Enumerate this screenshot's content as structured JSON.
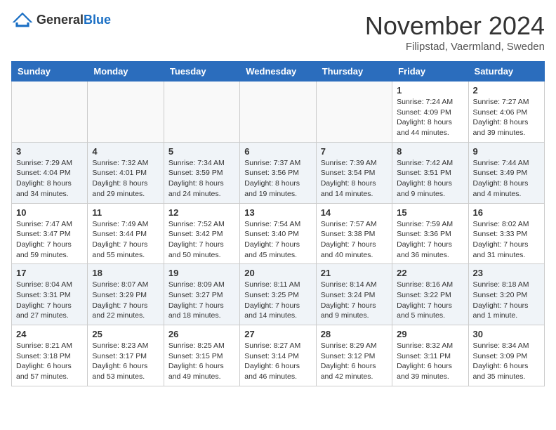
{
  "header": {
    "logo_general": "General",
    "logo_blue": "Blue",
    "month_title": "November 2024",
    "location": "Filipstad, Vaermland, Sweden"
  },
  "weekdays": [
    "Sunday",
    "Monday",
    "Tuesday",
    "Wednesday",
    "Thursday",
    "Friday",
    "Saturday"
  ],
  "weeks": [
    [
      {
        "day": "",
        "info": ""
      },
      {
        "day": "",
        "info": ""
      },
      {
        "day": "",
        "info": ""
      },
      {
        "day": "",
        "info": ""
      },
      {
        "day": "",
        "info": ""
      },
      {
        "day": "1",
        "info": "Sunrise: 7:24 AM\nSunset: 4:09 PM\nDaylight: 8 hours\nand 44 minutes."
      },
      {
        "day": "2",
        "info": "Sunrise: 7:27 AM\nSunset: 4:06 PM\nDaylight: 8 hours\nand 39 minutes."
      }
    ],
    [
      {
        "day": "3",
        "info": "Sunrise: 7:29 AM\nSunset: 4:04 PM\nDaylight: 8 hours\nand 34 minutes."
      },
      {
        "day": "4",
        "info": "Sunrise: 7:32 AM\nSunset: 4:01 PM\nDaylight: 8 hours\nand 29 minutes."
      },
      {
        "day": "5",
        "info": "Sunrise: 7:34 AM\nSunset: 3:59 PM\nDaylight: 8 hours\nand 24 minutes."
      },
      {
        "day": "6",
        "info": "Sunrise: 7:37 AM\nSunset: 3:56 PM\nDaylight: 8 hours\nand 19 minutes."
      },
      {
        "day": "7",
        "info": "Sunrise: 7:39 AM\nSunset: 3:54 PM\nDaylight: 8 hours\nand 14 minutes."
      },
      {
        "day": "8",
        "info": "Sunrise: 7:42 AM\nSunset: 3:51 PM\nDaylight: 8 hours\nand 9 minutes."
      },
      {
        "day": "9",
        "info": "Sunrise: 7:44 AM\nSunset: 3:49 PM\nDaylight: 8 hours\nand 4 minutes."
      }
    ],
    [
      {
        "day": "10",
        "info": "Sunrise: 7:47 AM\nSunset: 3:47 PM\nDaylight: 7 hours\nand 59 minutes."
      },
      {
        "day": "11",
        "info": "Sunrise: 7:49 AM\nSunset: 3:44 PM\nDaylight: 7 hours\nand 55 minutes."
      },
      {
        "day": "12",
        "info": "Sunrise: 7:52 AM\nSunset: 3:42 PM\nDaylight: 7 hours\nand 50 minutes."
      },
      {
        "day": "13",
        "info": "Sunrise: 7:54 AM\nSunset: 3:40 PM\nDaylight: 7 hours\nand 45 minutes."
      },
      {
        "day": "14",
        "info": "Sunrise: 7:57 AM\nSunset: 3:38 PM\nDaylight: 7 hours\nand 40 minutes."
      },
      {
        "day": "15",
        "info": "Sunrise: 7:59 AM\nSunset: 3:36 PM\nDaylight: 7 hours\nand 36 minutes."
      },
      {
        "day": "16",
        "info": "Sunrise: 8:02 AM\nSunset: 3:33 PM\nDaylight: 7 hours\nand 31 minutes."
      }
    ],
    [
      {
        "day": "17",
        "info": "Sunrise: 8:04 AM\nSunset: 3:31 PM\nDaylight: 7 hours\nand 27 minutes."
      },
      {
        "day": "18",
        "info": "Sunrise: 8:07 AM\nSunset: 3:29 PM\nDaylight: 7 hours\nand 22 minutes."
      },
      {
        "day": "19",
        "info": "Sunrise: 8:09 AM\nSunset: 3:27 PM\nDaylight: 7 hours\nand 18 minutes."
      },
      {
        "day": "20",
        "info": "Sunrise: 8:11 AM\nSunset: 3:25 PM\nDaylight: 7 hours\nand 14 minutes."
      },
      {
        "day": "21",
        "info": "Sunrise: 8:14 AM\nSunset: 3:24 PM\nDaylight: 7 hours\nand 9 minutes."
      },
      {
        "day": "22",
        "info": "Sunrise: 8:16 AM\nSunset: 3:22 PM\nDaylight: 7 hours\nand 5 minutes."
      },
      {
        "day": "23",
        "info": "Sunrise: 8:18 AM\nSunset: 3:20 PM\nDaylight: 7 hours\nand 1 minute."
      }
    ],
    [
      {
        "day": "24",
        "info": "Sunrise: 8:21 AM\nSunset: 3:18 PM\nDaylight: 6 hours\nand 57 minutes."
      },
      {
        "day": "25",
        "info": "Sunrise: 8:23 AM\nSunset: 3:17 PM\nDaylight: 6 hours\nand 53 minutes."
      },
      {
        "day": "26",
        "info": "Sunrise: 8:25 AM\nSunset: 3:15 PM\nDaylight: 6 hours\nand 49 minutes."
      },
      {
        "day": "27",
        "info": "Sunrise: 8:27 AM\nSunset: 3:14 PM\nDaylight: 6 hours\nand 46 minutes."
      },
      {
        "day": "28",
        "info": "Sunrise: 8:29 AM\nSunset: 3:12 PM\nDaylight: 6 hours\nand 42 minutes."
      },
      {
        "day": "29",
        "info": "Sunrise: 8:32 AM\nSunset: 3:11 PM\nDaylight: 6 hours\nand 39 minutes."
      },
      {
        "day": "30",
        "info": "Sunrise: 8:34 AM\nSunset: 3:09 PM\nDaylight: 6 hours\nand 35 minutes."
      }
    ]
  ]
}
